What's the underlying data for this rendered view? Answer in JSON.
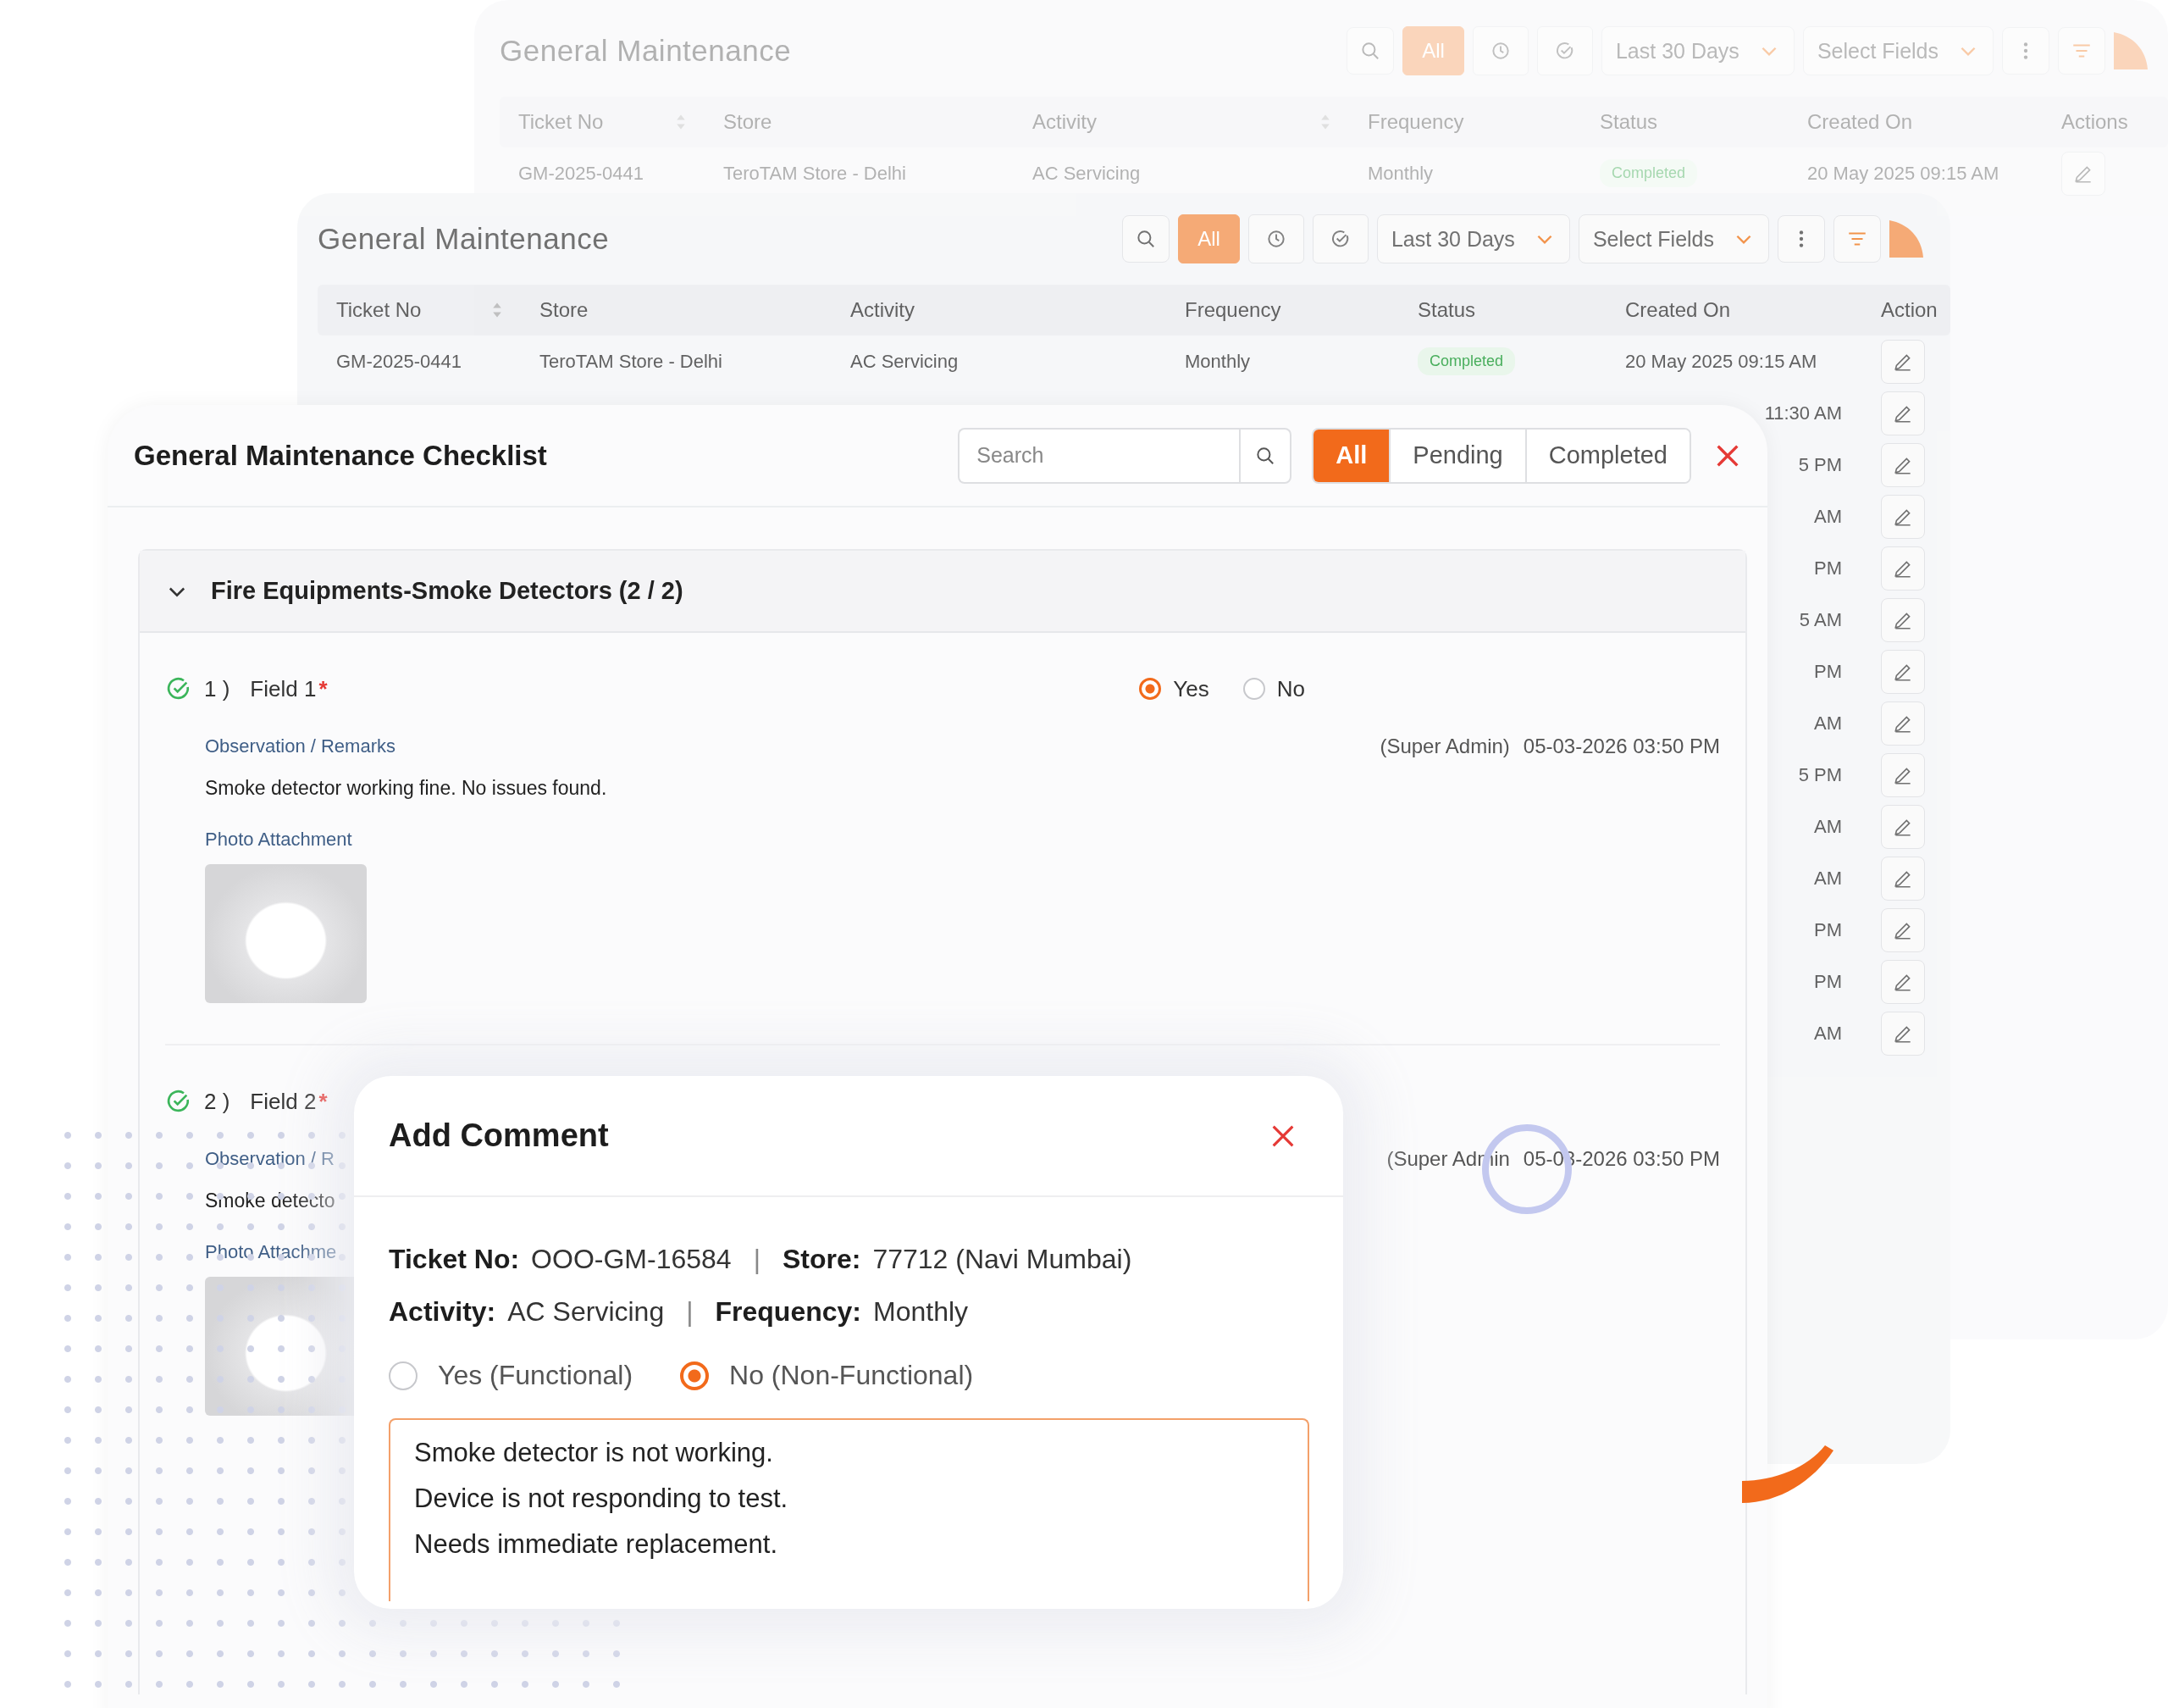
{
  "back_table": {
    "title": "General Maintenance",
    "filter_tabs": [
      {
        "kind": "text",
        "label": "All",
        "selected": true
      },
      {
        "kind": "clock",
        "selected": false
      },
      {
        "kind": "check",
        "selected": false
      }
    ],
    "date_range": "Last 30 Days",
    "fields_select": "Select Fields",
    "columns": [
      {
        "label": "Ticket No",
        "sortable": true
      },
      {
        "label": "Store",
        "sortable": false
      },
      {
        "label": "Activity",
        "sortable": true
      },
      {
        "label": "Frequency",
        "sortable": false
      },
      {
        "label": "Status",
        "sortable": false
      },
      {
        "label": "Created On",
        "sortable": false
      },
      {
        "label": "Actions",
        "sortable": false
      }
    ],
    "rows": [
      {
        "ticket_no": "GM-2025-0441",
        "store": "TeroTAM Store - Delhi",
        "activity": "AC Servicing",
        "frequency": "Monthly",
        "status": "Completed",
        "created_on": "20 May 2025 09:15 AM"
      }
    ]
  },
  "middle_table": {
    "title": "General Maintenance",
    "filter_tabs": [
      {
        "kind": "text",
        "label": "All",
        "selected": true
      },
      {
        "kind": "clock",
        "selected": false
      },
      {
        "kind": "check",
        "selected": false
      }
    ],
    "date_range": "Last 30 Days",
    "fields_select": "Select Fields",
    "columns": [
      {
        "label": "Ticket No",
        "sortable": true
      },
      {
        "label": "Store",
        "sortable": false
      },
      {
        "label": "Activity",
        "sortable": false
      },
      {
        "label": "Frequency",
        "sortable": false
      },
      {
        "label": "Status",
        "sortable": false
      },
      {
        "label": "Created On",
        "sortable": false
      },
      {
        "label": "Action",
        "sortable": false
      }
    ],
    "rows": [
      {
        "ticket_no": "GM-2025-0441",
        "store": "TeroTAM Store - Delhi",
        "activity": "AC Servicing",
        "frequency": "Monthly",
        "status": "Completed",
        "created_on": "20 May 2025 09:15 AM"
      }
    ],
    "partial_rows": [
      {
        "created_on": "11:30 AM"
      },
      {
        "created_on": "5 PM"
      },
      {
        "created_on": "AM"
      },
      {
        "created_on": "PM"
      },
      {
        "created_on": "5 AM"
      },
      {
        "created_on": "PM"
      },
      {
        "created_on": "AM"
      },
      {
        "created_on": "5 PM"
      },
      {
        "created_on": "AM"
      },
      {
        "created_on": "AM"
      },
      {
        "created_on": "PM"
      },
      {
        "created_on": "PM"
      },
      {
        "created_on": "AM"
      }
    ]
  },
  "checklist": {
    "title": "General Maintenance Checklist",
    "search": {
      "placeholder": "Search"
    },
    "filter_tabs": [
      {
        "label": "All",
        "selected": true
      },
      {
        "label": "Pending",
        "selected": false
      },
      {
        "label": "Completed",
        "selected": false
      }
    ],
    "sections": [
      {
        "title": "Fire Equipments-Smoke Detectors (2 / 2)",
        "expanded": true,
        "fields": [
          {
            "number": "1 )",
            "label": "Field 1",
            "required_mark": "*",
            "done": true,
            "answers": [
              {
                "label": "Yes",
                "selected": true
              },
              {
                "label": "No",
                "selected": false
              }
            ],
            "remarks_label": "Observation / Remarks",
            "author": "(Super Admin)",
            "timestamp": "05-03-2026 03:50 PM",
            "remark": "Smoke detector working fine. No issues found.",
            "photo_label": "Photo Attachment"
          },
          {
            "number": "2 )",
            "label": "Field 2",
            "required_mark": "*",
            "done": true,
            "remarks_label": "Observation / R",
            "author": "(Super Admin",
            "timestamp": "05-03-2026 03:50 PM",
            "remark": "Smoke detecto",
            "photo_label": "Photo Attachme"
          }
        ]
      }
    ]
  },
  "modal": {
    "title": "Add Comment",
    "info_lines": [
      {
        "separator": "|",
        "items": [
          {
            "label": "Ticket No:",
            "value": "OOO-GM-16584"
          },
          {
            "label": "Store:",
            "value": "77712 (Navi Mumbai)"
          }
        ]
      },
      {
        "separator": "|",
        "items": [
          {
            "label": "Activity:",
            "value": "AC Servicing"
          },
          {
            "label": "Frequency:",
            "value": "Monthly"
          }
        ]
      }
    ],
    "options": [
      {
        "label": "Yes (Functional)",
        "selected": false
      },
      {
        "label": "No (Non-Functional)",
        "selected": true
      }
    ],
    "comment": "Smoke detector is not working.\nDevice is not responding to test.\nNeeds immediate replacement."
  }
}
